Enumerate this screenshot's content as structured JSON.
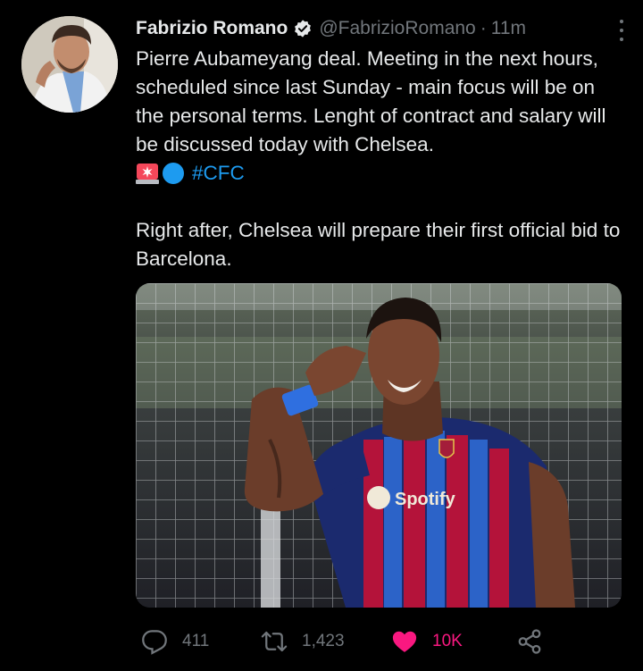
{
  "tweet": {
    "author_name": "Fabrizio Romano",
    "author_handle": "@FabrizioRomano",
    "separator": "·",
    "time": "11m",
    "line1": "Pierre Aubameyang deal. Meeting in the next hours, scheduled since last Sunday - main focus will be on the personal terms. Lenght of contract and salary will be discussed today with Chelsea.",
    "hashtag": "#CFC",
    "line2": "Right after, Chelsea will prepare their first official bid to Barcelona.",
    "jersey_sponsor": "Spotify"
  },
  "actions": {
    "replies": "411",
    "retweets": "1,423",
    "likes": "10K"
  },
  "colors": {
    "background": "#000000",
    "text": "#e7e9ea",
    "muted": "#71767b",
    "accent": "#1d9bf0",
    "like": "#f91880"
  },
  "icons": [
    "verified-badge-icon",
    "more-options-icon",
    "police-light-icon",
    "blue-circle-icon",
    "reply-icon",
    "retweet-icon",
    "heart-icon",
    "share-icon"
  ]
}
